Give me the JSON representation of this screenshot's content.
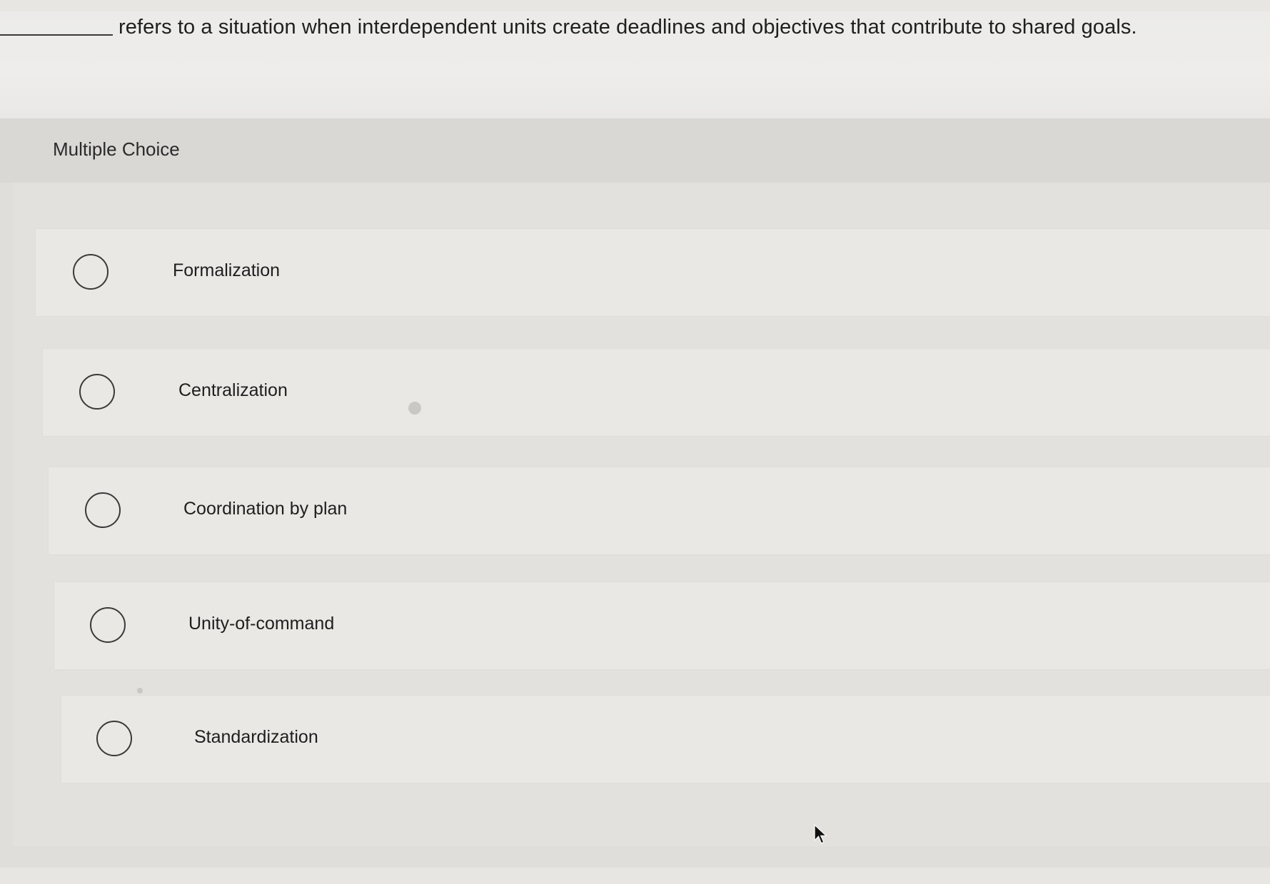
{
  "question": {
    "text": "refers to a situation when interdependent units create deadlines and objectives that contribute to shared goals."
  },
  "panel": {
    "label": "Multiple Choice"
  },
  "options": [
    {
      "label": "Formalization",
      "selected": false
    },
    {
      "label": "Centralization",
      "selected": false
    },
    {
      "label": "Coordination by plan",
      "selected": false
    },
    {
      "label": "Unity-of-command",
      "selected": false
    },
    {
      "label": "Standardization",
      "selected": false
    }
  ]
}
